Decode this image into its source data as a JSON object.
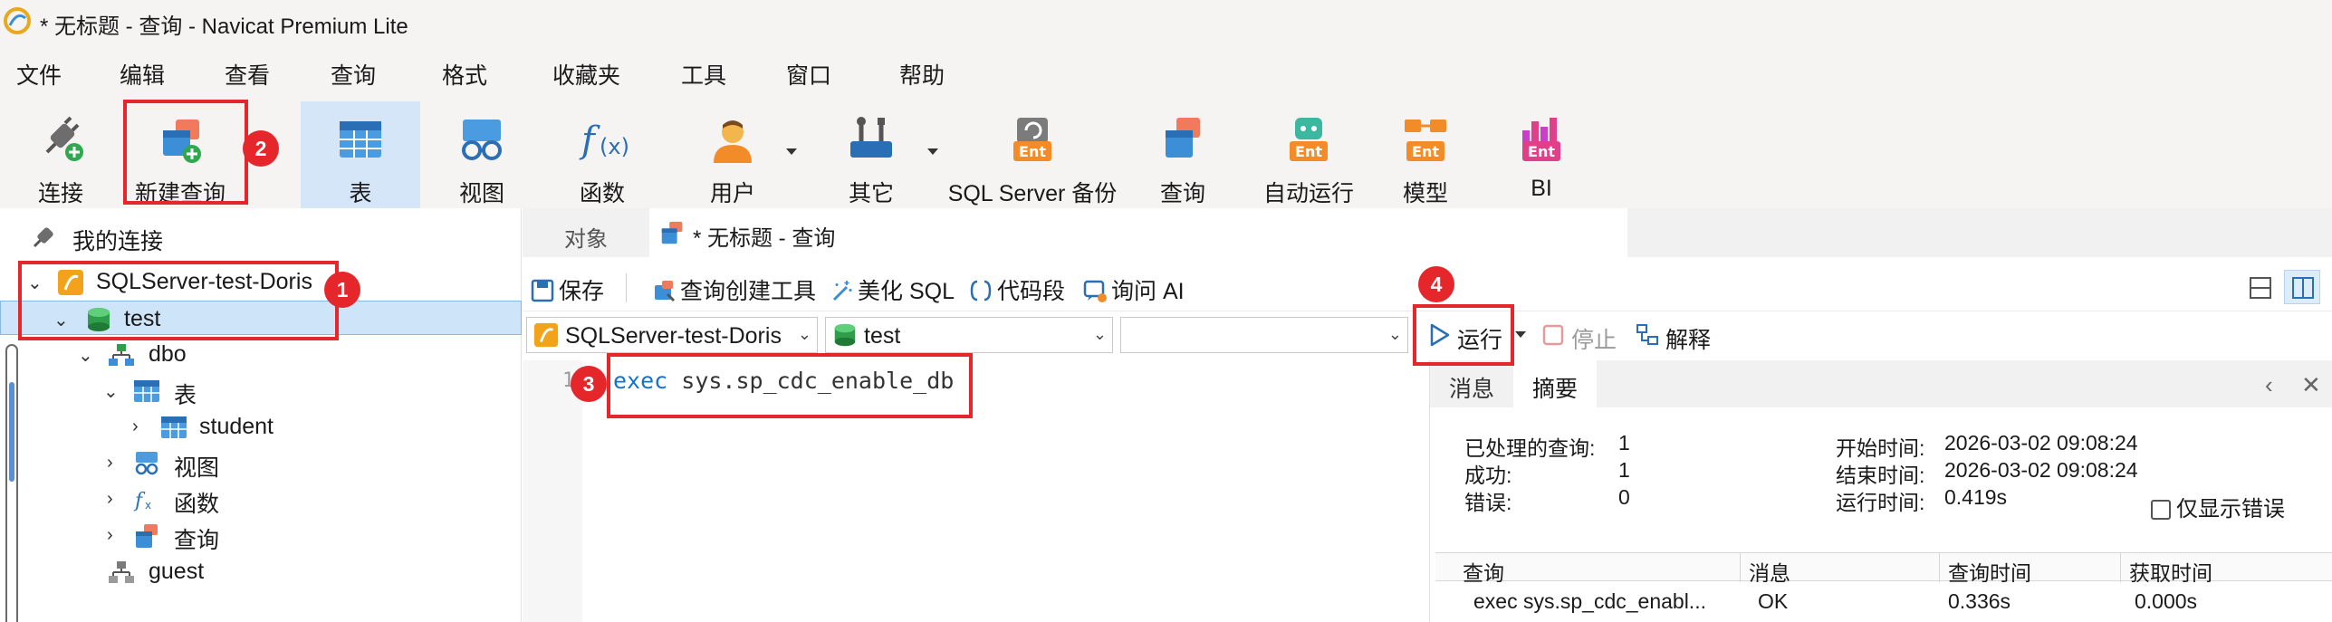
{
  "window": {
    "title": "* 无标题 - 查询 - Navicat Premium Lite"
  },
  "menu": [
    "文件",
    "编辑",
    "查看",
    "查询",
    "格式",
    "收藏夹",
    "工具",
    "窗口",
    "帮助"
  ],
  "toolbar": {
    "connect": "连接",
    "new_query": "新建查询",
    "table": "表",
    "view": "视图",
    "function": "函数",
    "user": "用户",
    "other": "其它",
    "sqlserver_backup": "SQL Server 备份",
    "query": "查询",
    "automation": "自动运行",
    "model": "模型",
    "bi": "BI",
    "ent_badge": "Ent"
  },
  "tree": {
    "root": "我的连接",
    "connection": "SQLServer-test-Doris",
    "database": "test",
    "schema": "dbo",
    "tables_folder": "表",
    "table": "student",
    "views_folder": "视图",
    "functions_folder": "函数",
    "queries_folder": "查询",
    "guest": "guest"
  },
  "tabs": {
    "objects": "对象",
    "query": "* 无标题 - 查询"
  },
  "query_toolbar": {
    "save": "保存",
    "query_builder": "查询创建工具",
    "beautify": "美化 SQL",
    "snippet": "代码段",
    "ask_ai": "询问 AI"
  },
  "selectors": {
    "connection": "SQLServer-test-Doris",
    "database": "test",
    "schema": ""
  },
  "actions": {
    "run": "运行",
    "stop": "停止",
    "explain": "解释"
  },
  "editor": {
    "line_number": "1",
    "keyword": "exec",
    "rest": " sys.sp_cdc_enable_db"
  },
  "result": {
    "tabs": {
      "message": "消息",
      "summary": "摘要"
    },
    "summary": {
      "processed_label": "已处理的查询:",
      "processed_value": "1",
      "success_label": "成功:",
      "success_value": "1",
      "error_label": "错误:",
      "error_value": "0",
      "start_label": "开始时间:",
      "start_value": "2026-03-02 09:08:24",
      "end_label": "结束时间:",
      "end_value": "2026-03-02 09:08:24",
      "elapsed_label": "运行时间:",
      "elapsed_value": "0.419s"
    },
    "only_errors": "仅显示错误",
    "table": {
      "headers": [
        "查询",
        "消息",
        "查询时间",
        "获取时间"
      ],
      "rows": [
        [
          "exec sys.sp_cdc_enabl...",
          "OK",
          "0.336s",
          "0.000s"
        ]
      ]
    }
  },
  "annotations": [
    "1",
    "2",
    "3",
    "4"
  ],
  "colors": {
    "annotation_red": "#e5262b",
    "keyword_blue": "#1673c9",
    "selection_blue": "#cde4f9"
  }
}
